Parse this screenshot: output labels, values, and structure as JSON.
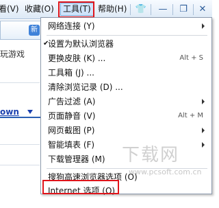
{
  "menubar": {
    "items": [
      "查看(V)",
      "收藏(O)",
      "工具(T)",
      "帮助(H)"
    ],
    "window_buttons": [
      "👕",
      "—",
      "❐",
      "✕"
    ]
  },
  "background": {
    "tab_text": "新",
    "line1": "玩游戏",
    "link": "own"
  },
  "menu": {
    "items": [
      {
        "label": "网络连接 (Y)",
        "shortcut": "",
        "submenu": true,
        "checked": false
      },
      {
        "label": "设置为默认浏览器",
        "shortcut": "",
        "submenu": false,
        "checked": true
      },
      {
        "label": "更换皮肤 (K) ...",
        "shortcut": "Alt + S",
        "submenu": false,
        "checked": false
      },
      {
        "label": "工具箱 (J) ...",
        "shortcut": "",
        "submenu": false,
        "checked": false
      },
      {
        "label": "清除浏览记录 (D) ...",
        "shortcut": "",
        "submenu": false,
        "checked": false
      },
      {
        "label": "广告过滤 (A)",
        "shortcut": "",
        "submenu": true,
        "checked": false
      },
      {
        "label": "页面静音 (V)",
        "shortcut": "Alt + M",
        "submenu": false,
        "checked": false
      },
      {
        "label": "网页截图 (P)",
        "shortcut": "",
        "submenu": true,
        "checked": false
      },
      {
        "label": "智能填表 (F)",
        "shortcut": "",
        "submenu": true,
        "checked": false
      },
      {
        "label": "下载管理器 (M)",
        "shortcut": "",
        "submenu": false,
        "checked": false
      },
      {
        "label": "搜狗高速浏览器选项 (O)",
        "shortcut": "",
        "submenu": false,
        "checked": false
      },
      {
        "label": "Internet 选项 (O)",
        "shortcut": "",
        "submenu": false,
        "checked": false
      }
    ]
  },
  "watermark": {
    "big": "下载网",
    "small": "www.pcsoft.com.cn"
  },
  "colors": {
    "highlight_border": "#e0141a",
    "menubar_bg": "#dde9f6",
    "link": "#1a3fae"
  }
}
